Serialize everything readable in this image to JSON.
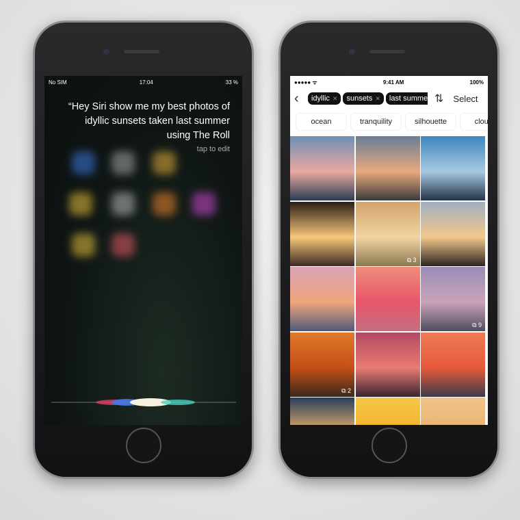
{
  "siri_screen": {
    "status": {
      "carrier": "No SIM",
      "time": "17:04",
      "battery": "33 %"
    },
    "query": "“Hey Siri show me my best photos of idyllic sunsets taken last summer using The Roll",
    "tap_to_edit": "tap to edit"
  },
  "app_screen": {
    "status": {
      "time": "9:41 AM",
      "battery": "100%"
    },
    "filters": [
      {
        "label": "idyllic"
      },
      {
        "label": "sunsets"
      },
      {
        "label": "last summer"
      }
    ],
    "select_label": "Select",
    "suggestions": [
      "ocean",
      "tranquility",
      "silhouette",
      "clouds"
    ],
    "photos": [
      {
        "colors": [
          "#6f8fb5",
          "#e9a9a0",
          "#2b3b55"
        ]
      },
      {
        "colors": [
          "#6a7d97",
          "#e8a97e",
          "#3a3a3a"
        ]
      },
      {
        "colors": [
          "#3d86c0",
          "#a7c9df",
          "#23324a"
        ]
      },
      {
        "colors": [
          "#2b1d17",
          "#f7c77a",
          "#3b2a22"
        ]
      },
      {
        "colors": [
          "#d3a46c",
          "#f2d4a2",
          "#8a7750"
        ],
        "count": "3"
      },
      {
        "colors": [
          "#9fb0c2",
          "#f3c78a",
          "#2b2520"
        ]
      },
      {
        "colors": [
          "#d9a3b6",
          "#f0a57c",
          "#4f5a7b"
        ]
      },
      {
        "colors": [
          "#f08c7a",
          "#e8566a",
          "#c46e80"
        ]
      },
      {
        "colors": [
          "#9a8db6",
          "#c9a3b8",
          "#4d4c60"
        ],
        "count": "9"
      },
      {
        "colors": [
          "#e07a2a",
          "#c44e18",
          "#3a2a1a"
        ],
        "count": "2"
      },
      {
        "colors": [
          "#b34964",
          "#e87b72",
          "#3a2530"
        ]
      },
      {
        "colors": [
          "#ee7a55",
          "#e65a3a",
          "#3b3b48"
        ]
      },
      {
        "colors": [
          "#2a3e5a",
          "#e7b170",
          "#2a2010"
        ]
      },
      {
        "colors": [
          "#f5c64a",
          "#f2b22a",
          "#d9a020"
        ]
      },
      {
        "colors": [
          "#f0c48a",
          "#e8b070",
          "#f7d9a0"
        ]
      }
    ]
  }
}
